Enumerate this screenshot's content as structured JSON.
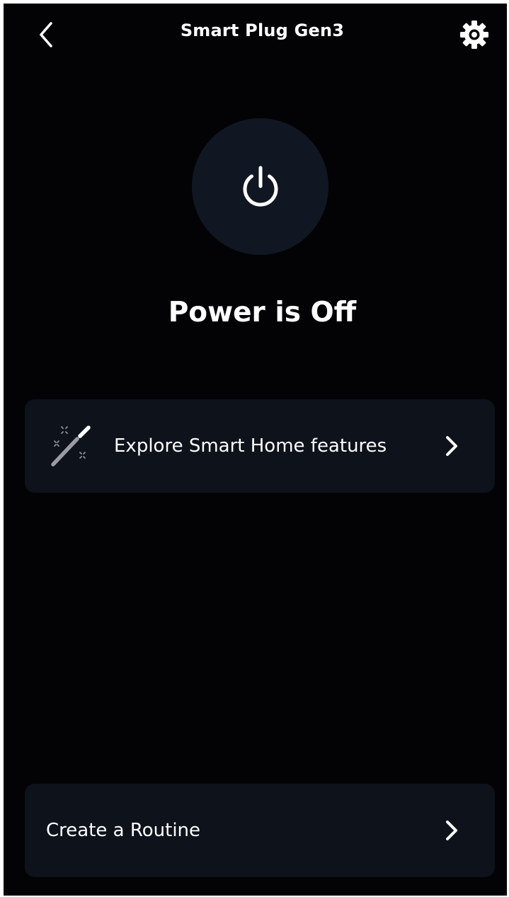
{
  "header": {
    "title": "Smart Plug Gen3",
    "back_icon": "chevron-left-icon",
    "settings_icon": "gear-icon"
  },
  "device": {
    "power_icon": "power-icon",
    "power_on": false,
    "status_text": "Power is Off"
  },
  "cards": {
    "explore": {
      "label": "Explore Smart Home features",
      "icon": "magic-wand-icon",
      "chevron": "chevron-right-icon"
    },
    "routine": {
      "label": "Create a Routine",
      "chevron": "chevron-right-icon"
    }
  },
  "colors": {
    "background": "#030305",
    "card": "#0d121b",
    "power_circle": "#111722",
    "text": "#ffffff",
    "wand_body": "#9a9ca3",
    "wand_tip": "#ffffff"
  }
}
